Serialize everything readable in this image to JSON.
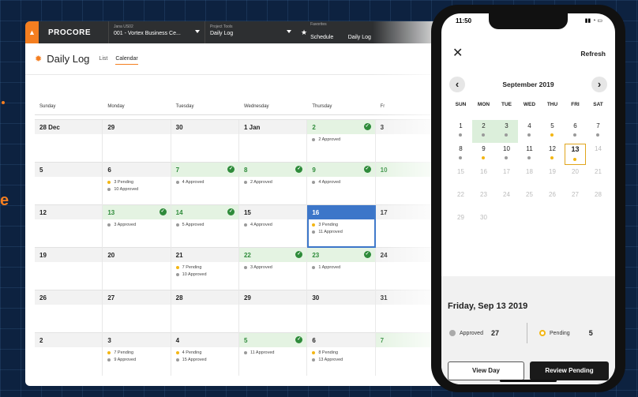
{
  "edge_text": "e",
  "desktop": {
    "logo": "PROCORE",
    "nav": [
      {
        "small": "Jana US02",
        "main": "001 - Vortex Business Ce..."
      },
      {
        "small": "Project Tools",
        "main": "Daily Log"
      }
    ],
    "favorites": {
      "small": "Favorites",
      "items": [
        "Schedule",
        "Daily Log"
      ]
    },
    "page_title": "Daily Log",
    "tabs": [
      "List",
      "Calendar"
    ],
    "weekdays": [
      "Sunday",
      "Monday",
      "Tuesday",
      "Wednesday",
      "Thursday",
      "Fr"
    ],
    "weeks": [
      [
        {
          "date": "28 Dec",
          "events": []
        },
        {
          "date": "29",
          "events": []
        },
        {
          "date": "30",
          "events": []
        },
        {
          "date": "1 Jan",
          "events": []
        },
        {
          "date": "2",
          "green": true,
          "events": [
            {
              "t": "2 Approved",
              "c": "g"
            }
          ]
        },
        {
          "date": "3",
          "events": []
        }
      ],
      [
        {
          "date": "5",
          "events": []
        },
        {
          "date": "6",
          "events": [
            {
              "t": "3 Pending",
              "c": "y"
            },
            {
              "t": "10 Approved",
              "c": "g"
            }
          ]
        },
        {
          "date": "7",
          "green": true,
          "events": [
            {
              "t": "4 Approved",
              "c": "g"
            }
          ]
        },
        {
          "date": "8",
          "green": true,
          "events": [
            {
              "t": "2 Approved",
              "c": "g"
            }
          ]
        },
        {
          "date": "9",
          "green": true,
          "events": [
            {
              "t": "4 Approved",
              "c": "g"
            }
          ]
        },
        {
          "date": "10",
          "green": true,
          "events": []
        }
      ],
      [
        {
          "date": "12",
          "events": []
        },
        {
          "date": "13",
          "green": true,
          "events": [
            {
              "t": "3 Approved",
              "c": "g"
            }
          ]
        },
        {
          "date": "14",
          "green": true,
          "events": [
            {
              "t": "5 Approved",
              "c": "g"
            }
          ]
        },
        {
          "date": "15",
          "events": [
            {
              "t": "4 Approved",
              "c": "g"
            }
          ]
        },
        {
          "date": "16",
          "selected": true,
          "events": [
            {
              "t": "3 Pending",
              "c": "y"
            },
            {
              "t": "11 Approved",
              "c": "g"
            }
          ]
        },
        {
          "date": "17",
          "events": []
        }
      ],
      [
        {
          "date": "19",
          "events": []
        },
        {
          "date": "20",
          "events": []
        },
        {
          "date": "21",
          "events": [
            {
              "t": "7 Pending",
              "c": "y"
            },
            {
              "t": "10 Approved",
              "c": "g"
            }
          ]
        },
        {
          "date": "22",
          "green": true,
          "events": [
            {
              "t": "3 Approved",
              "c": "g"
            }
          ]
        },
        {
          "date": "23",
          "green": true,
          "events": [
            {
              "t": "1 Approved",
              "c": "g"
            }
          ]
        },
        {
          "date": "24",
          "events": []
        }
      ],
      [
        {
          "date": "26",
          "events": []
        },
        {
          "date": "27",
          "events": []
        },
        {
          "date": "28",
          "events": []
        },
        {
          "date": "29",
          "events": []
        },
        {
          "date": "30",
          "events": []
        },
        {
          "date": "31",
          "events": []
        }
      ],
      [
        {
          "date": "2",
          "events": []
        },
        {
          "date": "3",
          "events": [
            {
              "t": "7 Pending",
              "c": "y"
            },
            {
              "t": "9 Approved",
              "c": "g"
            }
          ]
        },
        {
          "date": "4",
          "events": [
            {
              "t": "4 Pending",
              "c": "y"
            },
            {
              "t": "15 Approved",
              "c": "g"
            }
          ]
        },
        {
          "date": "5",
          "green": true,
          "events": [
            {
              "t": "11 Approved",
              "c": "g"
            }
          ]
        },
        {
          "date": "6",
          "events": [
            {
              "t": "8 Pending",
              "c": "y"
            },
            {
              "t": "13 Approved",
              "c": "g"
            }
          ]
        },
        {
          "date": "7",
          "green": true,
          "events": []
        }
      ]
    ]
  },
  "phone": {
    "time": "11:50",
    "refresh_label": "Refresh",
    "month": "September 2019",
    "dow": [
      "SUN",
      "MON",
      "TUE",
      "WED",
      "THU",
      "FRI",
      "SAT"
    ],
    "weeks": [
      [
        {
          "d": "1",
          "dot": "g"
        },
        {
          "d": "2",
          "dot": "g",
          "green": true
        },
        {
          "d": "3",
          "dot": "g",
          "green": true
        },
        {
          "d": "4",
          "dot": "g"
        },
        {
          "d": "5",
          "dot": "y"
        },
        {
          "d": "6",
          "dot": "g"
        },
        {
          "d": "7",
          "dot": "g"
        }
      ],
      [
        {
          "d": "8",
          "dot": "g"
        },
        {
          "d": "9",
          "dot": "y"
        },
        {
          "d": "10",
          "dot": "g"
        },
        {
          "d": "11",
          "dot": "g"
        },
        {
          "d": "12",
          "dot": "y"
        },
        {
          "d": "13",
          "dot": "y",
          "today": true
        },
        {
          "d": "14",
          "dim": true
        }
      ],
      [
        {
          "d": "15",
          "dim": true
        },
        {
          "d": "16",
          "dim": true
        },
        {
          "d": "17",
          "dim": true
        },
        {
          "d": "18",
          "dim": true
        },
        {
          "d": "19",
          "dim": true
        },
        {
          "d": "20",
          "dim": true
        },
        {
          "d": "21",
          "dim": true
        }
      ],
      [
        {
          "d": "22",
          "dim": true
        },
        {
          "d": "23",
          "dim": true
        },
        {
          "d": "24",
          "dim": true
        },
        {
          "d": "25",
          "dim": true
        },
        {
          "d": "26",
          "dim": true
        },
        {
          "d": "27",
          "dim": true
        },
        {
          "d": "28",
          "dim": true
        }
      ],
      [
        {
          "d": "29",
          "dim": true
        },
        {
          "d": "30",
          "dim": true
        }
      ]
    ],
    "summary_date": "Friday, Sep 13 2019",
    "approved_label": "Approved",
    "approved_value": "27",
    "pending_label": "Pending",
    "pending_value": "5",
    "view_day_label": "View Day",
    "review_pending_label": "Review Pending"
  }
}
